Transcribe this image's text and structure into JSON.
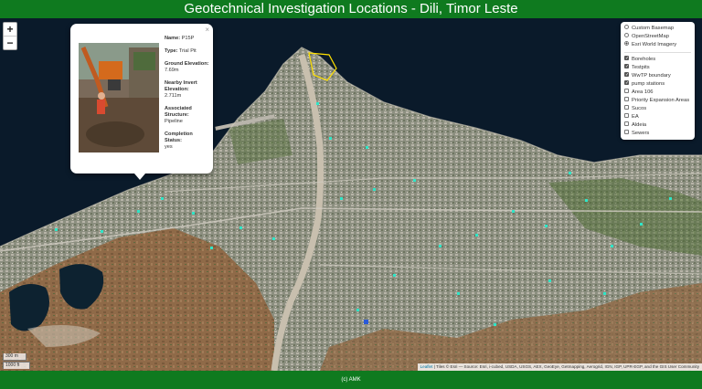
{
  "header": {
    "title": "Geotechnical Investigation Locations - Dili, Timor Leste"
  },
  "footer": {
    "text": "(c) AMK"
  },
  "zoom": {
    "in_label": "+",
    "out_label": "−"
  },
  "popup": {
    "close_label": "×",
    "fields": [
      {
        "key": "Name:",
        "value": "P15P",
        "inline": true
      },
      {
        "key": "Type:",
        "value": "Trial Pit",
        "inline": true
      },
      {
        "key": "Ground Elevation:",
        "value": "7.69m",
        "inline": false
      },
      {
        "key": "Nearby Invert Elevation:",
        "value": "2.711m",
        "inline": false
      },
      {
        "key": "Associated Structure:",
        "value": "Pipeline",
        "inline": false
      },
      {
        "key": "Completion Status:",
        "value": "yes",
        "inline": false
      }
    ]
  },
  "layers": {
    "basemaps": [
      {
        "label": "Custom Basemap",
        "selected": false
      },
      {
        "label": "OpenStreetMap",
        "selected": false
      },
      {
        "label": "Esri World Imagery",
        "selected": true
      }
    ],
    "overlays": [
      {
        "label": "Boreholes",
        "checked": true
      },
      {
        "label": "Testpits",
        "checked": true
      },
      {
        "label": "WwTP boundary",
        "checked": true
      },
      {
        "label": "pump stations",
        "checked": true
      },
      {
        "label": "Area 106",
        "checked": false
      },
      {
        "label": "Priority Expansion Areas",
        "checked": false
      },
      {
        "label": "Sucos",
        "checked": false
      },
      {
        "label": "EA",
        "checked": false
      },
      {
        "label": "Aldeia",
        "checked": false
      },
      {
        "label": "Sewers",
        "checked": false
      }
    ]
  },
  "scale": {
    "meters": "300 m",
    "feet": "1000 ft"
  },
  "attribution": {
    "leaflet": "Leaflet",
    "text": " | Tiles © Esri — Source: Esri, i-cubed, USDA, USGS, AEX, GeoEye, Getmapping, Aerogrid, IGN, IGP, UPR-EGP, and the GIS User Community"
  },
  "colors": {
    "header_bg": "#0f7a1f",
    "sea": "#0a1a2a",
    "marker": "#2ee6c8",
    "wwtp_boundary": "#ffe000"
  }
}
